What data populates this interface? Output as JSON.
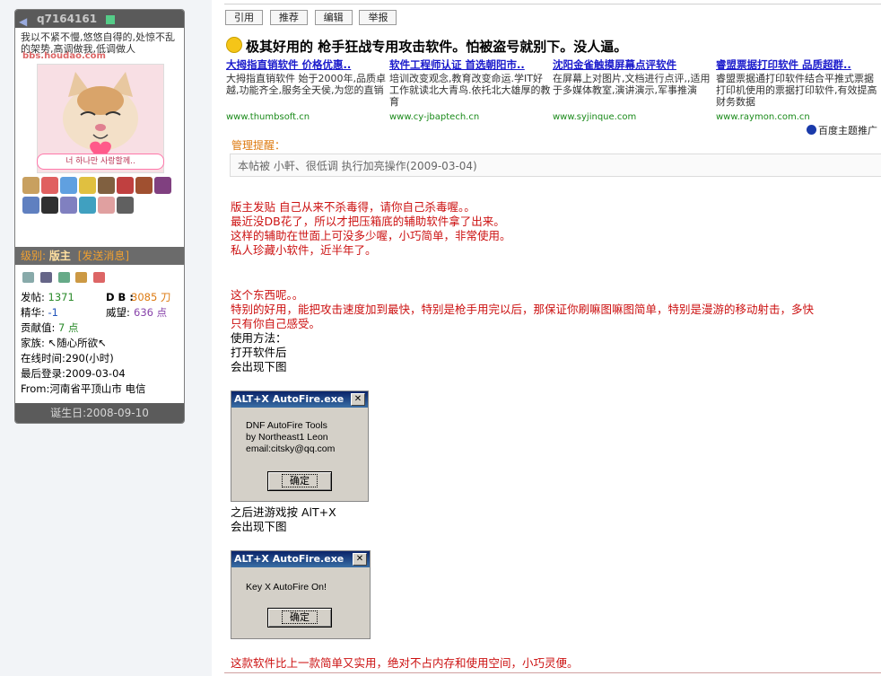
{
  "user": {
    "name": "q7164161",
    "signature": "我以不紧不慢,悠悠自得的,处惊不乱的架势,高调做我,低调做人",
    "watermark": "bbs.houdao.com",
    "avatar_caption": "너 하나만 사랑할께..",
    "rank_label": "级别:",
    "rank_value": "版主",
    "send_msg": "[发送消息]",
    "stats": {
      "posts_label": "发帖:",
      "posts": "1371",
      "db_label": "D B :",
      "db": "3085 刀",
      "essence_label": "精华:",
      "essence": "-1",
      "prestige_label": "威望:",
      "prestige": "636 点",
      "contrib_label": "贡献值:",
      "contrib": "7 点",
      "family": "家族: ↖随心所欲↖",
      "online": "在线时间:290(小时)",
      "last_login": "最后登录:2009-03-04",
      "from": "From:河南省平顶山市 电信"
    },
    "birthday": "诞生日:2008-09-10",
    "medal_colors": [
      "#c8a060",
      "#e06060",
      "#60a0e0",
      "#e0c040",
      "#806040",
      "#c04040",
      "#a05030",
      "#804080",
      "#6080c0",
      "#303030",
      "#8080c0",
      "#40a0c0",
      "#e0a0a0",
      "#606060"
    ]
  },
  "actions": [
    "引用",
    "推荐",
    "编辑",
    "举报"
  ],
  "post": {
    "title": "极其好用的  枪手狂战专用攻击软件。怕被盗号就别下。没人逼。",
    "ads": [
      {
        "title": "大拇指直销软件  价格优惠..",
        "desc": "大拇指直销软件 始于2000年,品质卓越,功能齐全,服务全天侯,为您的直销",
        "url": "www.thumbsoft.cn"
      },
      {
        "title": "软件工程师认证 首选朝阳市..",
        "desc": "培训改变观念,教育改变命运.学IT好工作就读北大青鸟.依托北大雄厚的教育",
        "url": "www.cy-jbaptech.cn"
      },
      {
        "title": "沈阳金雀触摸屏幕点评软件",
        "desc": "在屏幕上对图片,文档进行点评,,适用于多媒体教室,演讲演示,军事推演",
        "url": "www.syjinque.com"
      },
      {
        "title": "睿盟票据打印软件 品质超群..",
        "desc": "睿盟票据通打印软件结合平推式票据打印机使用的票据打印软件,有效提高财务数据",
        "url": "www.raymon.com.cn"
      }
    ],
    "baidu": "百度主题推广",
    "notice_label": "管理提醒：",
    "notice": "本帖被  小軒、很低调  执行加亮操作(2009-03-04)",
    "para1": [
      "版主发贴  自己从来不杀毒得，请你自己杀毒喔。。",
      "最近没DB花了，所以才把压箱底的辅助软件拿了出来。",
      "这样的辅助在世面上可没多少喔，小巧简单，非常使用。",
      "私人珍藏小软件，近半年了。"
    ],
    "para2": [
      "这个东西呢。。",
      "特别的好用，能把攻击速度加到最快，特别是枪手用完以后，那保证你刷嘛图嘛图简单，特别是漫游的移动射击，多快",
      "只有你自己感受。"
    ],
    "usage": [
      "使用方法：",
      "打开软件后",
      "会出现下图"
    ],
    "dialog1": {
      "title": "ALT+X AutoFire.exe",
      "close": "✕",
      "lines": [
        "DNF AutoFire Tools",
        "by Northeast1 Leon",
        "email:citsky@qq.com"
      ],
      "ok": "确定"
    },
    "after1": [
      "之后进游戏按  AlT+X",
      "会出现下图"
    ],
    "dialog2": {
      "title": "ALT+X AutoFire.exe",
      "close": "✕",
      "lines": [
        "Key X AutoFire On!"
      ],
      "ok": "确定"
    },
    "footer": "这款软件比上一款简单又实用，绝对不占内存和使用空间，小巧灵便。"
  }
}
